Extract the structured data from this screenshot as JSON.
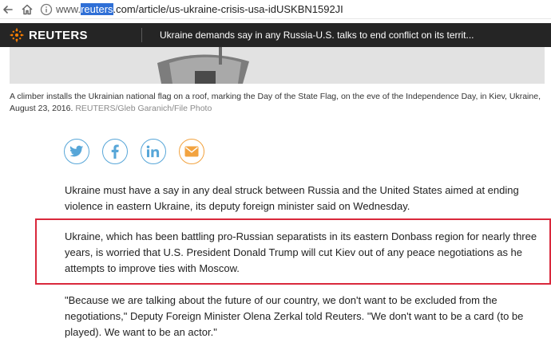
{
  "browser": {
    "url_prefix": "www.",
    "url_domain_highlight": "reuters",
    "url_rest": ".com/article/us-ukraine-crisis-usa-idUSKBN1592JI"
  },
  "topbar": {
    "logo_text": "REUTERS",
    "headline": "Ukraine demands say in any Russia-U.S. talks to end conflict on its territ..."
  },
  "photo": {
    "caption": "A climber installs the Ukrainian national flag on a roof, marking the Day of the State Flag, on the eve of the Independence Day, in Kiev, Ukraine, August 23, 2016.",
    "credit": "REUTERS/Gleb Garanich/File Photo"
  },
  "share": {
    "icons": [
      "twitter-icon",
      "facebook-icon",
      "linkedin-icon",
      "email-icon"
    ]
  },
  "article": {
    "paragraphs": [
      "Ukraine must have a say in any deal struck between Russia and the United States aimed at ending violence in eastern Ukraine, its deputy foreign minister said on Wednesday.",
      "Ukraine, which has been battling pro-Russian separatists in its eastern Donbass region for nearly three years, is worried that U.S. President Donald Trump will cut Kiev out of any peace negotiations as he attempts to improve ties with Moscow.",
      "\"Because we are talking about the future of our country, we don't want to be excluded from the negotiations,\" Deputy Foreign Minister Olena Zerkal told Reuters. \"We don't want to be a card (to be played). We want to be an actor.\""
    ]
  },
  "colors": {
    "topbar_bg": "#252525",
    "share_blue": "#57a6d8",
    "email_orange": "#f2a340",
    "highlight_red": "#d9283c",
    "url_highlight": "#2f6fd6"
  }
}
